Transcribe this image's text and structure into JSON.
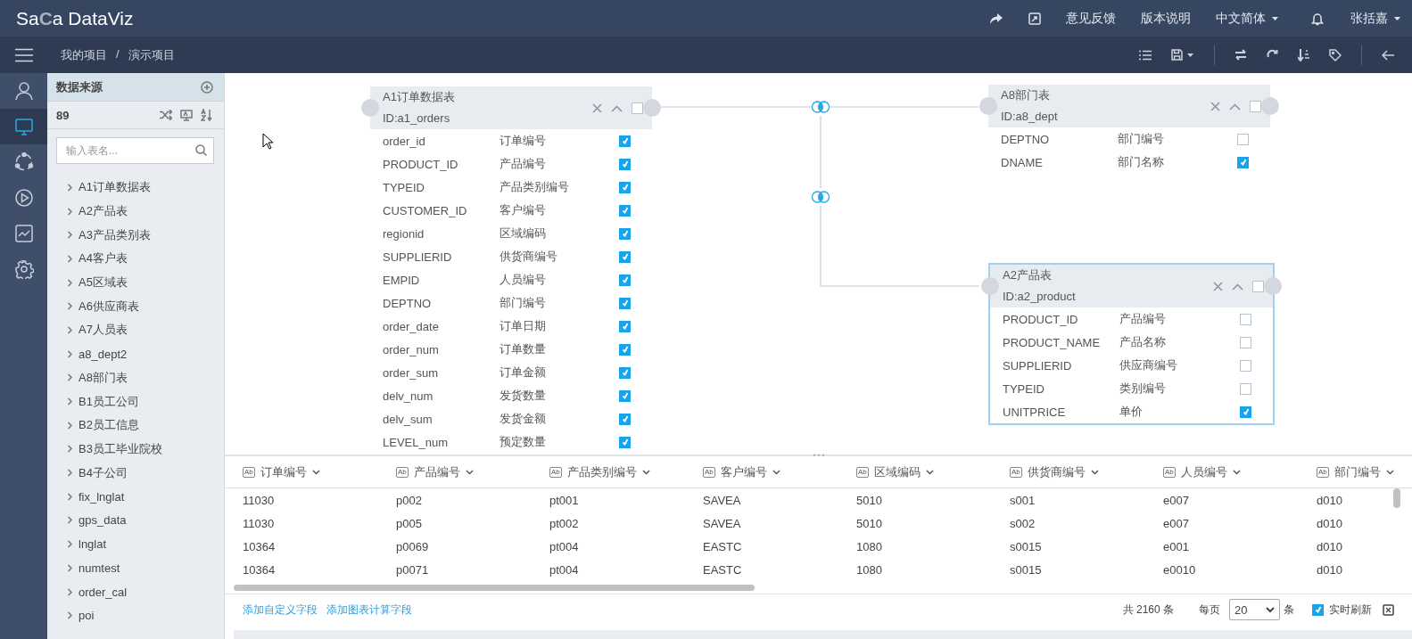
{
  "header": {
    "logo": {
      "before": "Sa",
      "mark": "C",
      "after": "a DataViz"
    },
    "links": [
      {
        "label": "意见反馈",
        "dropdown": false
      },
      {
        "label": "版本说明",
        "dropdown": false
      },
      {
        "label": "中文简体",
        "dropdown": true
      }
    ],
    "user": {
      "name": "张括嘉",
      "dropdown": true
    }
  },
  "breadcrumb": {
    "items": [
      "我的项目",
      "演示项目"
    ],
    "separator": "/"
  },
  "rail": [
    {
      "selected": false
    },
    {
      "selected": true
    },
    {
      "selected": false
    },
    {
      "selected": false
    },
    {
      "selected": false
    },
    {
      "selected": false
    }
  ],
  "source_panel": {
    "title": "数据来源",
    "count": "89",
    "search": {
      "placeholder": "输入表名..."
    },
    "tables": [
      {
        "name": "A1订单数据表",
        "expanded": false
      },
      {
        "name": "A2产品表",
        "expanded": false
      },
      {
        "name": "A3产品类别表",
        "expanded": false
      },
      {
        "name": "A4客户表",
        "expanded": false
      },
      {
        "name": "A5区域表",
        "expanded": false
      },
      {
        "name": "A6供应商表",
        "expanded": false
      },
      {
        "name": "A7人员表",
        "expanded": false
      },
      {
        "name": "a8_dept2",
        "expanded": false
      },
      {
        "name": "A8部门表",
        "expanded": false
      },
      {
        "name": "B1员工公司",
        "expanded": false
      },
      {
        "name": "B2员工信息",
        "expanded": false
      },
      {
        "name": "B3员工毕业院校",
        "expanded": false
      },
      {
        "name": "B4子公司",
        "expanded": false
      },
      {
        "name": "fix_lnglat",
        "expanded": false
      },
      {
        "name": "gps_data",
        "expanded": false
      },
      {
        "name": "lnglat",
        "expanded": false
      },
      {
        "name": "numtest",
        "expanded": false
      },
      {
        "name": "order_cal",
        "expanded": false
      },
      {
        "name": "poi",
        "expanded": false
      }
    ]
  },
  "canvas": {
    "tables": [
      {
        "title": "A1订单数据表",
        "id": "ID:a1_orders",
        "selected": false,
        "checked": false,
        "fields": [
          {
            "name": "order_id",
            "label": "订单编号",
            "checked": true
          },
          {
            "name": "PRODUCT_ID",
            "label": "产品编号",
            "checked": true
          },
          {
            "name": "TYPEID",
            "label": "产品类别编号",
            "checked": true
          },
          {
            "name": "CUSTOMER_ID",
            "label": "客户编号",
            "checked": true
          },
          {
            "name": "regionid",
            "label": "区域编码",
            "checked": true
          },
          {
            "name": "SUPPLIERID",
            "label": "供货商编号",
            "checked": true
          },
          {
            "name": "EMPID",
            "label": "人员编号",
            "checked": true
          },
          {
            "name": "DEPTNO",
            "label": "部门编号",
            "checked": true
          },
          {
            "name": "order_date",
            "label": "订单日期",
            "checked": true
          },
          {
            "name": "order_num",
            "label": "订单数量",
            "checked": true
          },
          {
            "name": "order_sum",
            "label": "订单金额",
            "checked": true
          },
          {
            "name": "delv_num",
            "label": "发货数量",
            "checked": true
          },
          {
            "name": "delv_sum",
            "label": "发货金额",
            "checked": true
          },
          {
            "name": "LEVEL_num",
            "label": "预定数量",
            "checked": true
          }
        ]
      },
      {
        "title": "A8部门表",
        "id": "ID:a8_dept",
        "selected": false,
        "checked": false,
        "fields": [
          {
            "name": "DEPTNO",
            "label": "部门编号",
            "checked": false
          },
          {
            "name": "DNAME",
            "label": "部门名称",
            "checked": true
          }
        ]
      },
      {
        "title": "A2产品表",
        "id": "ID:a2_product",
        "selected": true,
        "checked": false,
        "fields": [
          {
            "name": "PRODUCT_ID",
            "label": "产品编号",
            "checked": false
          },
          {
            "name": "PRODUCT_NAME",
            "label": "产品名称",
            "checked": false
          },
          {
            "name": "SUPPLIERID",
            "label": "供应商编号",
            "checked": false
          },
          {
            "name": "TYPEID",
            "label": "类别编号",
            "checked": false
          },
          {
            "name": "UNITPRICE",
            "label": "单价",
            "checked": true
          }
        ]
      }
    ]
  },
  "data_grid": {
    "columns": [
      {
        "label": "订单编号",
        "type": "Ab"
      },
      {
        "label": "产品编号",
        "type": "Ab"
      },
      {
        "label": "产品类别编号",
        "type": "Ab"
      },
      {
        "label": "客户编号",
        "type": "Ab"
      },
      {
        "label": "区域编码",
        "type": "Ab"
      },
      {
        "label": "供货商编号",
        "type": "Ab"
      },
      {
        "label": "人员编号",
        "type": "Ab"
      },
      {
        "label": "部门编号",
        "type": "Ab"
      }
    ],
    "rows": [
      [
        "11030",
        "p002",
        "pt001",
        "SAVEA",
        "5010",
        "s001",
        "e007",
        "d010"
      ],
      [
        "11030",
        "p005",
        "pt002",
        "SAVEA",
        "5010",
        "s002",
        "e007",
        "d010"
      ],
      [
        "10364",
        "p0069",
        "pt004",
        "EASTC",
        "1080",
        "s0015",
        "e001",
        "d010"
      ],
      [
        "10364",
        "p0071",
        "pt004",
        "EASTC",
        "1080",
        "s0015",
        "e0010",
        "d010"
      ]
    ],
    "footer": {
      "links": [
        "添加自定义字段",
        "添加图表计算字段"
      ],
      "total": "共 2160 条",
      "page_size_label": "每页",
      "page_size": "20",
      "page_size_unit": "条",
      "realtime": {
        "label": "实时刷新",
        "checked": true
      }
    }
  }
}
